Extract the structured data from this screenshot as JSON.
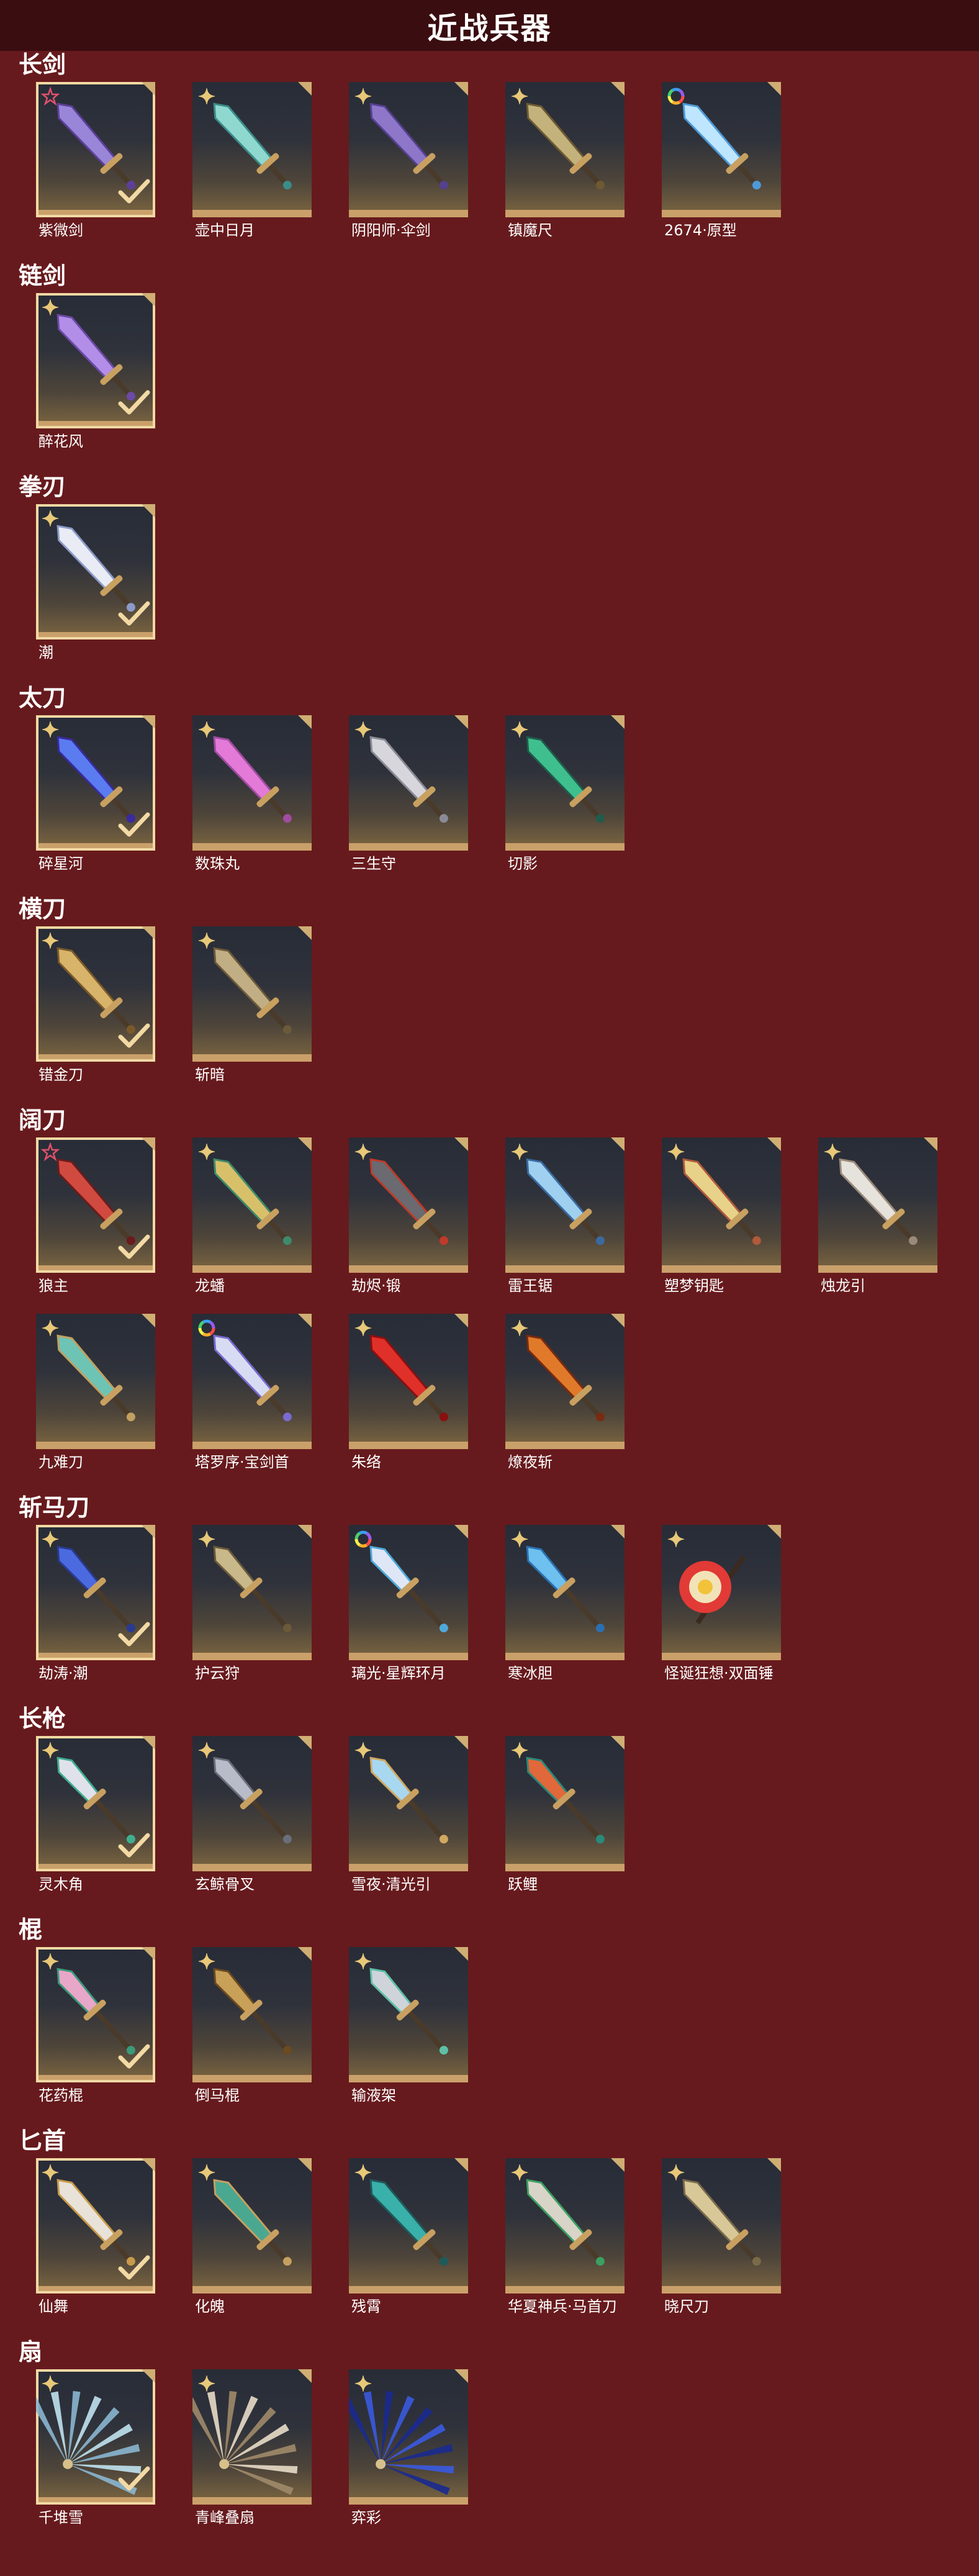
{
  "page": {
    "title": "近战兵器"
  },
  "colors": {
    "background": "#671a1d",
    "header": "#3a0d10",
    "frame_bottom": "#caa06a",
    "selected_border": "#f2d9a4"
  },
  "categories": [
    {
      "name": "长剑",
      "items": [
        {
          "name": "紫微剑",
          "rarity": "star-pink",
          "selected": true,
          "icon": "purple-ornate-sword",
          "blade": "#9a86d8",
          "accent": "#5d3f9a"
        },
        {
          "name": "壶中日月",
          "rarity": "star-gold",
          "selected": false,
          "icon": "teal-jade-sword",
          "blade": "#8fd8d0",
          "accent": "#3b8c88"
        },
        {
          "name": "阴阳师·伞剑",
          "rarity": "star-gold",
          "selected": false,
          "icon": "purple-umbrella-sword",
          "blade": "#8e76c9",
          "accent": "#55408f"
        },
        {
          "name": "镇魔尺",
          "rarity": "star-gold",
          "selected": false,
          "icon": "bronze-ruler-sword",
          "blade": "#c3b27c",
          "accent": "#6e5a32"
        },
        {
          "name": "2674·原型",
          "rarity": "rainbow-ring",
          "selected": false,
          "icon": "blue-light-saber",
          "blade": "#bfe6ff",
          "accent": "#4d9ad8"
        }
      ]
    },
    {
      "name": "链剑",
      "items": [
        {
          "name": "醉花风",
          "rarity": "star-gold",
          "selected": true,
          "icon": "purple-chain-sword",
          "blade": "#b28ee8",
          "accent": "#6c4aa6"
        }
      ]
    },
    {
      "name": "拳刃",
      "items": [
        {
          "name": "潮",
          "rarity": "star-gold",
          "selected": true,
          "icon": "white-feather-claw",
          "blade": "#e9ecf5",
          "accent": "#8b9ac8"
        }
      ]
    },
    {
      "name": "太刀",
      "items": [
        {
          "name": "碎星河",
          "rarity": "star-gold",
          "selected": true,
          "icon": "blue-purple-katana",
          "blade": "#5a7cf0",
          "accent": "#3a2aa0"
        },
        {
          "name": "数珠丸",
          "rarity": "star-gold",
          "selected": false,
          "icon": "pink-beaded-katana",
          "blade": "#e47ad8",
          "accent": "#a04ca0"
        },
        {
          "name": "三生守",
          "rarity": "star-gold",
          "selected": false,
          "icon": "silver-twin-katana",
          "blade": "#d6d6dc",
          "accent": "#8a8a96"
        },
        {
          "name": "切影",
          "rarity": "star-gold",
          "selected": false,
          "icon": "green-shadow-katana",
          "blade": "#3fbf8e",
          "accent": "#1f5c4c"
        }
      ]
    },
    {
      "name": "横刀",
      "items": [
        {
          "name": "错金刀",
          "rarity": "star-gold",
          "selected": true,
          "icon": "gold-inlaid-blade",
          "blade": "#d8b36a",
          "accent": "#7a5a2a"
        },
        {
          "name": "斩暗",
          "rarity": "star-gold",
          "selected": false,
          "icon": "bronze-sheathed-blade",
          "blade": "#c2ae84",
          "accent": "#6b5a3a"
        }
      ]
    },
    {
      "name": "阔刀",
      "items": [
        {
          "name": "狼主",
          "rarity": "star-pink",
          "selected": true,
          "icon": "red-wolf-broadsword",
          "blade": "#d04a40",
          "accent": "#6a1c1c"
        },
        {
          "name": "龙蟠",
          "rarity": "star-gold",
          "selected": false,
          "icon": "gold-dragon-broadsword",
          "blade": "#d8c06a",
          "accent": "#3e8a6a"
        },
        {
          "name": "劫烬·锻",
          "rarity": "star-gold",
          "selected": false,
          "icon": "dark-ember-broadsword",
          "blade": "#6a6a70",
          "accent": "#c03a2a"
        },
        {
          "name": "雷王锯",
          "rarity": "star-gold",
          "selected": false,
          "icon": "blue-thunder-saw",
          "blade": "#9fd0f0",
          "accent": "#3a6aa0"
        },
        {
          "name": "塑梦钥匙",
          "rarity": "star-gold",
          "selected": false,
          "icon": "gold-dream-key",
          "blade": "#e8d28a",
          "accent": "#b05a3a"
        },
        {
          "name": "烛龙引",
          "rarity": "star-gold",
          "selected": false,
          "icon": "white-dragon-blade",
          "blade": "#e6e2dc",
          "accent": "#9a8a7a"
        },
        {
          "name": "九难刀",
          "rarity": "star-gold",
          "selected": false,
          "icon": "teal-nine-rings-blade",
          "blade": "#6ec4b4",
          "accent": "#c2a060"
        },
        {
          "name": "塔罗序·宝剑首",
          "rarity": "rainbow-ring",
          "selected": false,
          "icon": "tarot-sword",
          "blade": "#d8dcf2",
          "accent": "#7a6ad0"
        },
        {
          "name": "朱络",
          "rarity": "star-gold",
          "selected": false,
          "icon": "red-crystal-blade",
          "blade": "#e0302a",
          "accent": "#8a1010"
        },
        {
          "name": "燎夜斩",
          "rarity": "star-gold",
          "selected": false,
          "icon": "flame-night-blade",
          "blade": "#e07a2a",
          "accent": "#7a2a10"
        }
      ]
    },
    {
      "name": "斩马刀",
      "items": [
        {
          "name": "劫涛·潮",
          "rarity": "star-gold",
          "selected": true,
          "icon": "blue-wave-glaive",
          "blade": "#4c6ae0",
          "accent": "#2a3a90"
        },
        {
          "name": "护云狩",
          "rarity": "star-gold",
          "selected": false,
          "icon": "bronze-cloud-glaive",
          "blade": "#c8b88a",
          "accent": "#6a5a3a"
        },
        {
          "name": "璃光·星辉环月",
          "rarity": "rainbow-ring",
          "selected": false,
          "icon": "moon-ring-glaive",
          "blade": "#dfe6f5",
          "accent": "#4fa8d8"
        },
        {
          "name": "寒冰胆",
          "rarity": "star-gold",
          "selected": false,
          "icon": "ice-crystal-glaive",
          "blade": "#6ec0ee",
          "accent": "#2a70b0"
        },
        {
          "name": "怪诞狂想·双面锤",
          "rarity": "star-gold",
          "selected": false,
          "icon": "jester-hammer",
          "blade": "#e23a36",
          "accent": "#f2c23a"
        }
      ]
    },
    {
      "name": "长枪",
      "items": [
        {
          "name": "灵木角",
          "rarity": "star-gold",
          "selected": true,
          "icon": "silver-antler-spear",
          "blade": "#dfe2ea",
          "accent": "#3fae8e"
        },
        {
          "name": "玄鲸骨叉",
          "rarity": "star-gold",
          "selected": false,
          "icon": "whale-bone-trident",
          "blade": "#b8bcc8",
          "accent": "#6a6e7a"
        },
        {
          "name": "雪夜·清光引",
          "rarity": "star-gold",
          "selected": false,
          "icon": "snow-night-spear",
          "blade": "#a8d8f0",
          "accent": "#d0a860"
        },
        {
          "name": "跃鲤",
          "rarity": "star-gold",
          "selected": false,
          "icon": "koi-spear",
          "blade": "#e0683a",
          "accent": "#2a8a7a"
        }
      ]
    },
    {
      "name": "棍",
      "items": [
        {
          "name": "花药棍",
          "rarity": "star-gold",
          "selected": true,
          "icon": "flower-staff",
          "blade": "#e8a6c8",
          "accent": "#3a9a7a"
        },
        {
          "name": "倒马棍",
          "rarity": "star-gold",
          "selected": false,
          "icon": "gold-staff",
          "blade": "#c8a058",
          "accent": "#6a4a20"
        },
        {
          "name": "输液架",
          "rarity": "star-gold",
          "selected": false,
          "icon": "iv-stand-staff",
          "blade": "#cfd4da",
          "accent": "#5ec0a6"
        }
      ]
    },
    {
      "name": "匕首",
      "items": [
        {
          "name": "仙舞",
          "rarity": "star-gold",
          "selected": true,
          "icon": "dance-dagger",
          "blade": "#e8e2d8",
          "accent": "#c89a4a"
        },
        {
          "name": "化魄",
          "rarity": "star-gold",
          "selected": false,
          "icon": "green-curved-dagger",
          "blade": "#4aa890",
          "accent": "#c4a060"
        },
        {
          "name": "残霄",
          "rarity": "star-gold",
          "selected": false,
          "icon": "teal-curved-dagger",
          "blade": "#3ab0aa",
          "accent": "#1f5a5a"
        },
        {
          "name": "华夏神兵·马首刀",
          "rarity": "star-gold",
          "selected": false,
          "icon": "horse-head-dagger",
          "blade": "#d8d4c8",
          "accent": "#3aa060"
        },
        {
          "name": "晓尺刀",
          "rarity": "star-gold",
          "selected": false,
          "icon": "dawn-dagger",
          "blade": "#d8c898",
          "accent": "#7a6a4a"
        }
      ]
    },
    {
      "name": "扇",
      "items": [
        {
          "name": "千堆雪",
          "rarity": "star-gold",
          "selected": true,
          "icon": "snow-fan",
          "blade": "#bfe2f0",
          "accent": "#8ab6d0"
        },
        {
          "name": "青峰叠扇",
          "rarity": "star-gold",
          "selected": false,
          "icon": "folding-fan",
          "blade": "#e8dcc8",
          "accent": "#a08a6a"
        },
        {
          "name": "弈彩",
          "rarity": "star-gold",
          "selected": false,
          "icon": "blue-wave-fan",
          "blade": "#3a5ae0",
          "accent": "#1a2a90"
        }
      ]
    }
  ]
}
